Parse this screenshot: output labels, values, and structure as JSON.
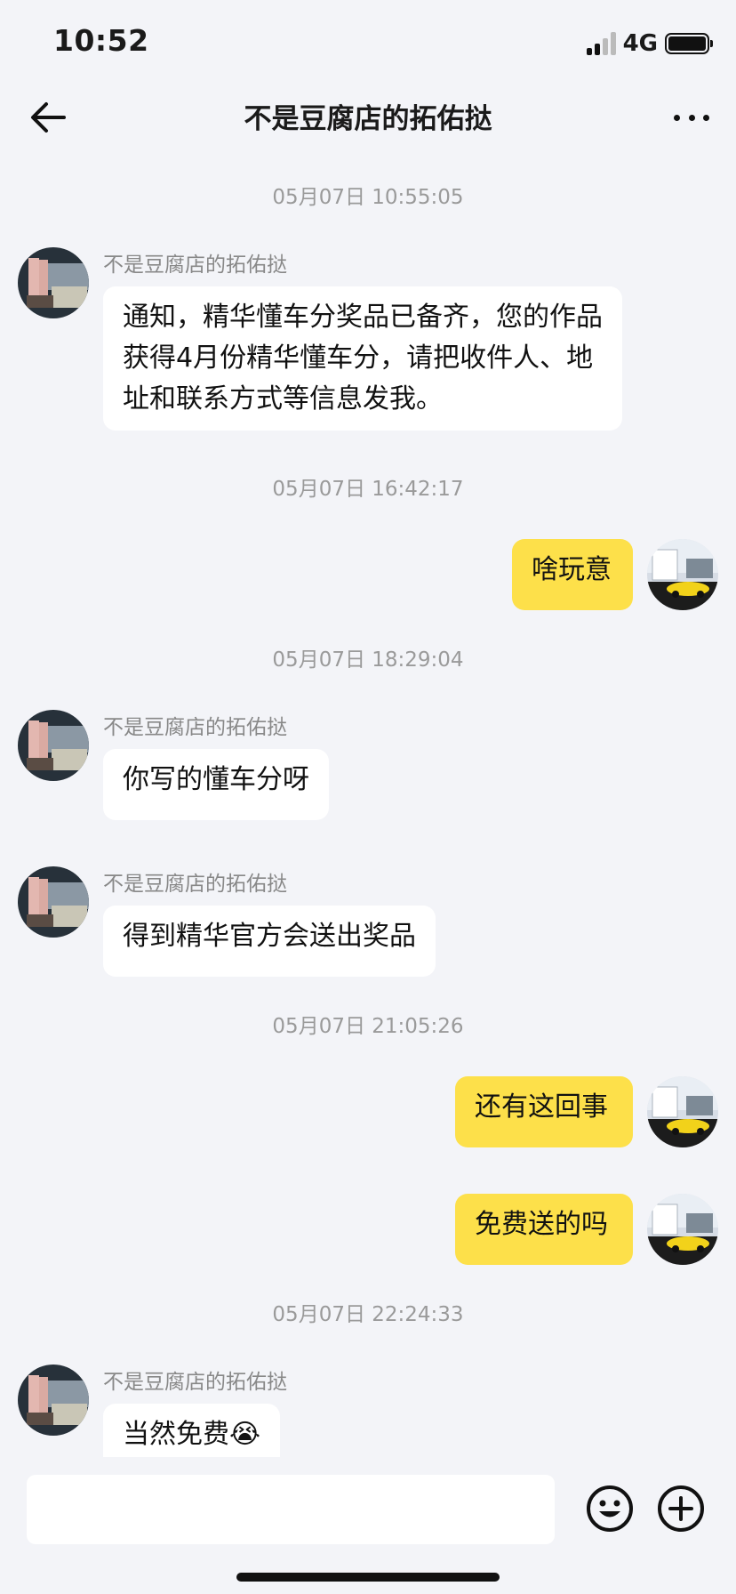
{
  "status_bar": {
    "time": "10:52",
    "network": "4G"
  },
  "header": {
    "title": "不是豆腐店的拓佑挞"
  },
  "messages": [
    {
      "type": "timestamp",
      "text": "05月07日 10:55:05"
    },
    {
      "type": "incoming",
      "sender": "不是豆腐店的拓佑挞",
      "text": "通知，精华懂车分奖品已备齐，您的作品获得4月份精华懂车分，请把收件人、地址和联系方式等信息发我。"
    },
    {
      "type": "timestamp",
      "text": "05月07日 16:42:17"
    },
    {
      "type": "outgoing",
      "text": "啥玩意"
    },
    {
      "type": "timestamp",
      "text": "05月07日 18:29:04"
    },
    {
      "type": "incoming",
      "sender": "不是豆腐店的拓佑挞",
      "text": "你写的懂车分呀"
    },
    {
      "type": "incoming",
      "sender": "不是豆腐店的拓佑挞",
      "text": "得到精华官方会送出奖品"
    },
    {
      "type": "timestamp",
      "text": "05月07日 21:05:26"
    },
    {
      "type": "outgoing",
      "text": "还有这回事"
    },
    {
      "type": "outgoing",
      "text": "免费送的吗"
    },
    {
      "type": "timestamp",
      "text": "05月07日 22:24:33"
    },
    {
      "type": "incoming",
      "sender": "不是豆腐店的拓佑挞",
      "text": "当然免费",
      "emoji": "😭"
    }
  ],
  "input": {
    "placeholder": ""
  },
  "icons": {
    "back": "arrow-left-icon",
    "more": "more-dots-icon",
    "emoji": "smiley-icon",
    "plus": "plus-circle-icon"
  },
  "colors": {
    "outgoing_bubble": "#fde04a",
    "incoming_bubble": "#ffffff",
    "background": "#f3f4f8"
  }
}
